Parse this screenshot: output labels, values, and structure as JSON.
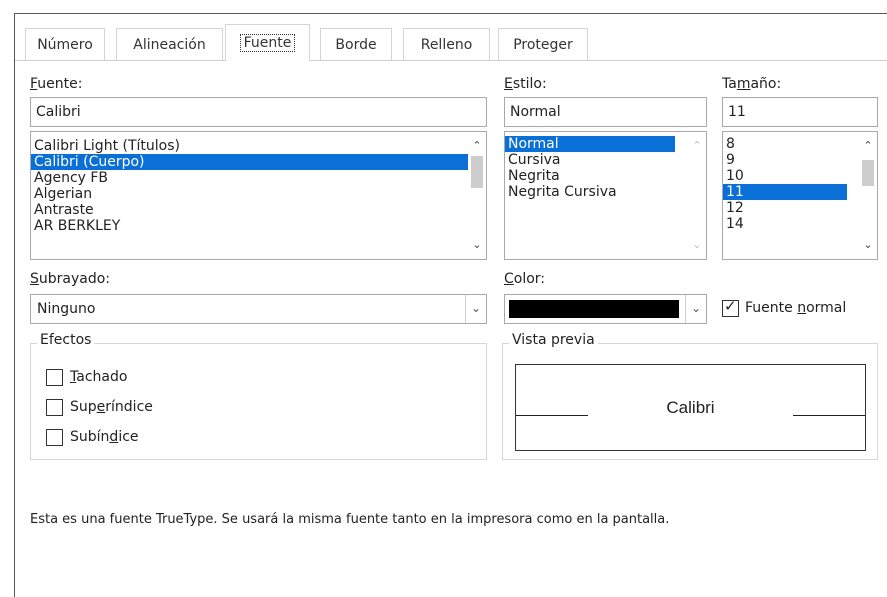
{
  "tabs": [
    {
      "label": "Número"
    },
    {
      "label": "Alineación"
    },
    {
      "label": "Fuente"
    },
    {
      "label": "Borde"
    },
    {
      "label": "Relleno"
    },
    {
      "label": "Proteger"
    }
  ],
  "font": {
    "label_first": "F",
    "label_rest": "uente:",
    "value": "Calibri",
    "list": [
      "Calibri Light (Títulos)",
      "Calibri (Cuerpo)",
      "Agency FB",
      "Algerian",
      "Antraste",
      "AR BERKLEY"
    ],
    "selected": "Calibri (Cuerpo)"
  },
  "style": {
    "label_first": "E",
    "label_rest": "stilo:",
    "value": "Normal",
    "list": [
      "Normal",
      "Cursiva",
      "Negrita",
      "Negrita Cursiva"
    ],
    "selected": "Normal"
  },
  "size": {
    "label_pre": "Ta",
    "label_u": "m",
    "label_post": "año:",
    "value": "11",
    "list": [
      "8",
      "9",
      "10",
      "11",
      "12",
      "14"
    ],
    "selected": "11"
  },
  "underline": {
    "label_first": "S",
    "label_rest": "ubrayado:",
    "value": "Ninguno"
  },
  "color": {
    "label_first": "C",
    "label_rest": "olor:",
    "swatch": "#000000"
  },
  "normal_font": {
    "checked": true,
    "label_pre": "Fuente ",
    "label_u": "n",
    "label_post": "ormal"
  },
  "effects": {
    "title": "Efectos",
    "items": [
      {
        "pre": "",
        "u": "T",
        "post": "achado",
        "checked": false
      },
      {
        "pre": "Sup",
        "u": "e",
        "post": "ríndice",
        "checked": false
      },
      {
        "pre": "Subín",
        "u": "d",
        "post": "ice",
        "checked": false
      }
    ]
  },
  "preview": {
    "title": "Vista previa",
    "sample": "Calibri"
  },
  "info_text": "Esta es una fuente TrueType. Se usará la misma fuente tanto en la impresora como en la pantalla.",
  "colors": {
    "selection": "#0a6fd6",
    "border": "#a9a9a9",
    "group_border": "#d6d6d6"
  }
}
